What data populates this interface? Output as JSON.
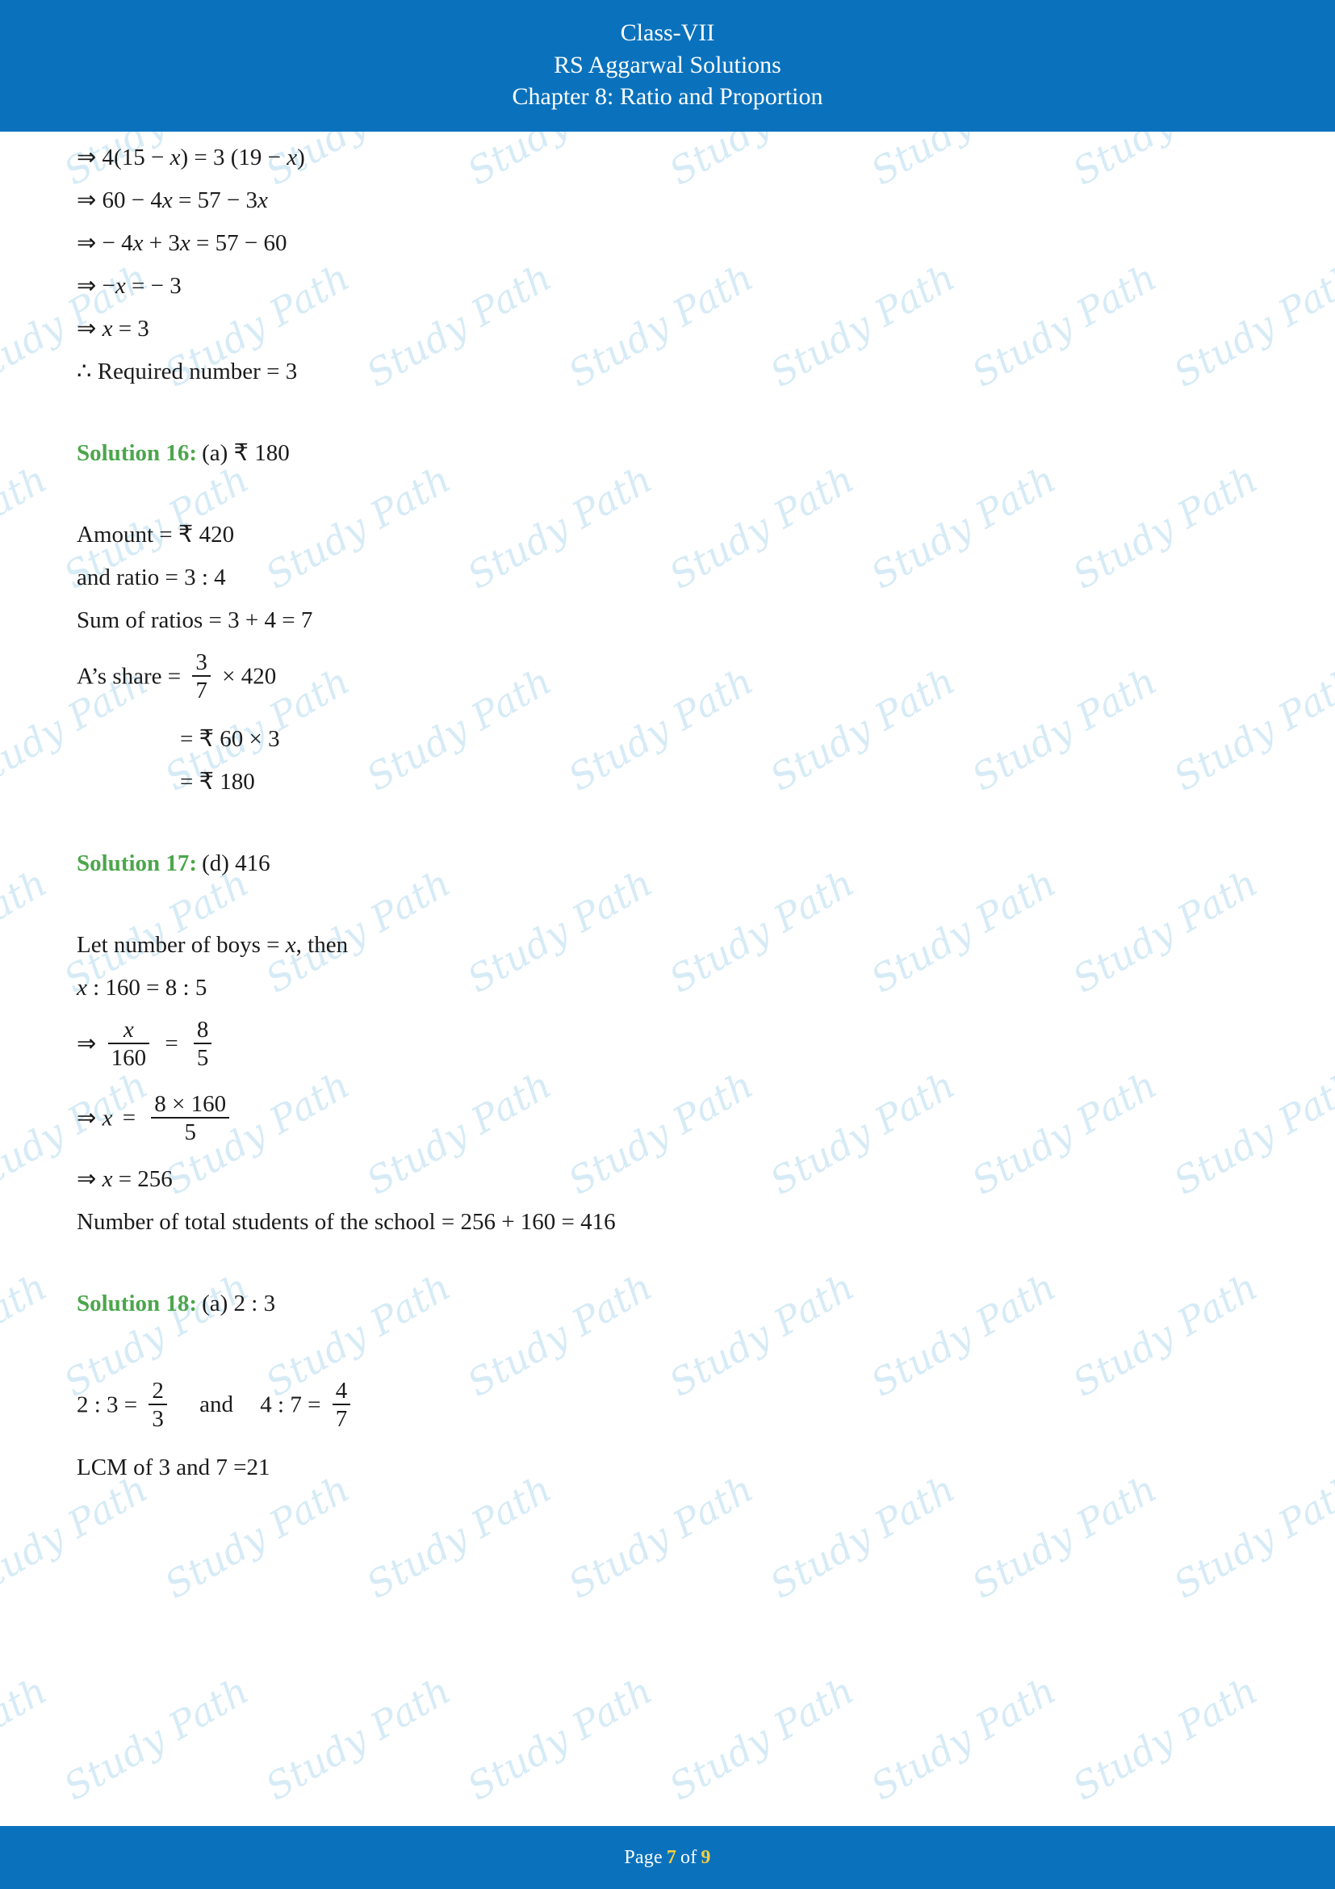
{
  "header": {
    "line1": "Class-VII",
    "line2": "RS Aggarwal Solutions",
    "line3": "Chapter 8: Ratio and Proportion"
  },
  "footer": {
    "prefix": "Page",
    "page": "7",
    "of": "of",
    "total": "9"
  },
  "watermark": {
    "text": "Study Path"
  },
  "body": {
    "eq1": "⇒ 4(15 − x) = 3 (19 − x)",
    "eq1_a": "⇒ 4(15 −",
    "eq1_b": ") = 3 (19 −",
    "eq1_c": ")",
    "eq2_a": "⇒ 60 − 4",
    "eq2_b": "= 57 − 3",
    "eq3_a": "⇒ − 4",
    "eq3_b": "+ 3",
    "eq3_c": "= 57 − 60",
    "eq4_a": "⇒ −",
    "eq4_b": "= − 3",
    "eq5_a": "⇒",
    "eq5_b": "= 3",
    "eq6": "∴ Required number = 3",
    "sol16_label": "Solution 16:",
    "sol16_answer": "(a) ₹ 180",
    "s16_l1": "Amount = ₹ 420",
    "s16_l2": "and ratio = 3 : 4",
    "s16_l3": "Sum of ratios = 3 + 4 = 7",
    "s16_l4_pre": "A’s share =",
    "s16_l4_num": "3",
    "s16_l4_den": "7",
    "s16_l4_post": "× 420",
    "s16_l5": "= ₹ 60 × 3",
    "s16_l6": "= ₹ 180",
    "sol17_label": "Solution 17:",
    "sol17_answer": "(d) 416",
    "s17_l1_a": "Let number of boys =",
    "s17_l1_b": ", then",
    "s17_l2_a": ": 160 = 8 : 5",
    "s17_l3_pre": "⇒",
    "s17_l3_num1": "x",
    "s17_l3_den1": "160",
    "s17_l3_eq": "=",
    "s17_l3_num2": "8",
    "s17_l3_den2": "5",
    "s17_l4_pre": "⇒",
    "s17_l4_var": "x",
    "s17_l4_eq": "=",
    "s17_l4_num": "8 × 160",
    "s17_l4_den": "5",
    "s17_l5_pre": "⇒",
    "s17_l5_var": "x",
    "s17_l5_post": "= 256",
    "s17_l6": "Number of total students of the school = 256 + 160 = 416",
    "sol18_label": "Solution 18:",
    "sol18_answer": "(a) 2 : 3",
    "s18_l1_a": "2 : 3 =",
    "s18_l1_num1": "2",
    "s18_l1_den1": "3",
    "s18_l1_and": "and",
    "s18_l1_b": "4 : 7 =",
    "s18_l1_num2": "4",
    "s18_l1_den2": "7",
    "s18_l2": "LCM of 3 and 7 =21"
  }
}
